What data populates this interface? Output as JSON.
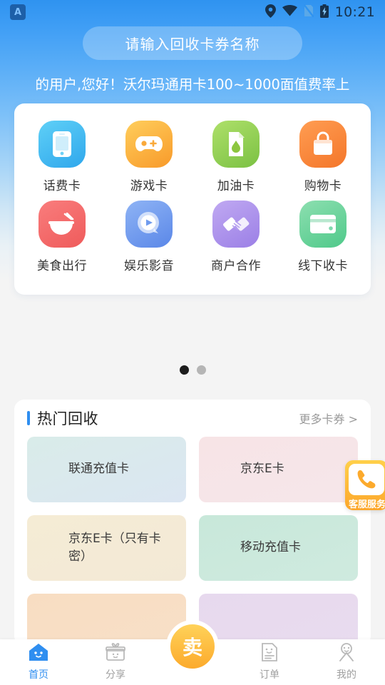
{
  "statusbar": {
    "app_icon": "app-badge-icon",
    "icons": [
      "location-icon",
      "wifi-icon",
      "sim-icon",
      "battery-charging-icon"
    ],
    "time": "10:21"
  },
  "search": {
    "placeholder": "请输入回收卡券名称",
    "icon": "search-input"
  },
  "notice": {
    "text": "的用户,您好！沃尔玛通用卡100~1000面值费率上"
  },
  "categories": [
    {
      "label": "话费卡",
      "icon": "phone-card-icon",
      "color": "#2fa7ec"
    },
    {
      "label": "游戏卡",
      "icon": "gamepad-icon",
      "color": "#f89a2a"
    },
    {
      "label": "加油卡",
      "icon": "fuel-can-icon",
      "color": "#7bc143"
    },
    {
      "label": "购物卡",
      "icon": "shopping-bag-icon",
      "color": "#f4762a"
    },
    {
      "label": "美食出行",
      "icon": "food-bowl-icon",
      "color": "#ef5b5b"
    },
    {
      "label": "娱乐影音",
      "icon": "play-circle-icon",
      "color": "#5a87e8"
    },
    {
      "label": "商户合作",
      "icon": "handshake-icon",
      "color": "#9b7fe6"
    },
    {
      "label": "线下收卡",
      "icon": "credit-card-icon",
      "color": "#4fc98a"
    }
  ],
  "pager": {
    "total": 2,
    "active": 0
  },
  "hot": {
    "title": "热门回收",
    "more_label": "更多卡券 >",
    "cards": [
      {
        "name": "联通充值卡"
      },
      {
        "name": "京东E卡"
      },
      {
        "name": "京东E卡（只有卡密）"
      },
      {
        "name": "移动充值卡"
      },
      {
        "name": ""
      },
      {
        "name": ""
      }
    ]
  },
  "customer_service": {
    "label": "客服服务",
    "icon": "phone-call-icon"
  },
  "tabbar": {
    "items": [
      {
        "label": "首页",
        "icon": "home-icon",
        "active": true
      },
      {
        "label": "分享",
        "icon": "gift-icon",
        "active": false
      },
      {
        "label": "卖",
        "icon": "sell-button",
        "active": false
      },
      {
        "label": "订单",
        "icon": "order-icon",
        "active": false
      },
      {
        "label": "我的",
        "icon": "person-icon",
        "active": false
      }
    ]
  },
  "colors": {
    "brand_blue": "#2f8ef0",
    "accent_orange": "#fcaa2c",
    "inactive_gray": "#a0a0a0"
  }
}
